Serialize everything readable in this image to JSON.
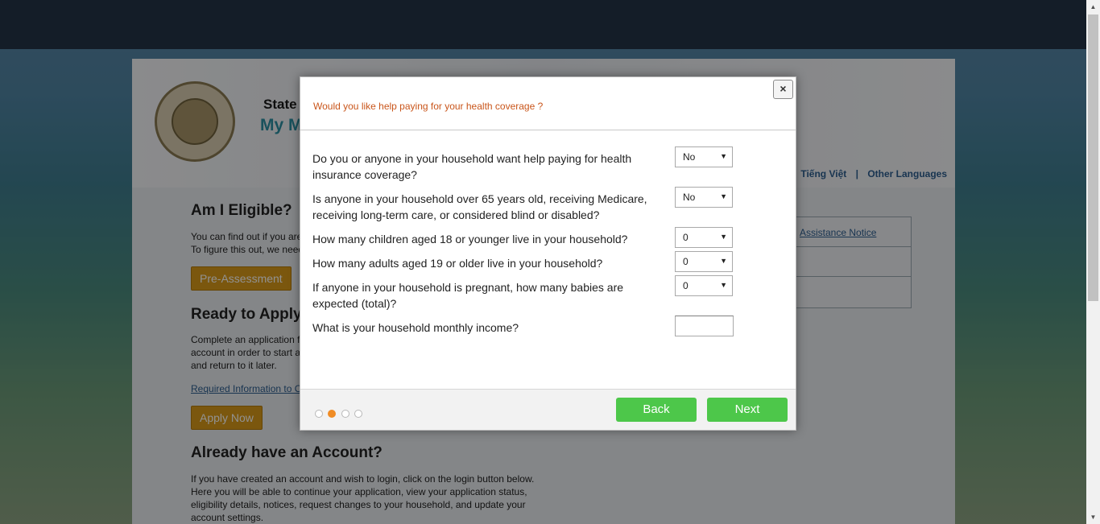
{
  "background_page": {
    "state_title": "State",
    "my_title": "My M",
    "languages": [
      "Tiếng Việt",
      "Other Languages"
    ],
    "lang_separator": "|",
    "right_panel_items": [
      "Assistance Notice",
      "",
      ""
    ],
    "eligible_heading": "Am I Eligible?",
    "eligible_text": [
      "You can find out if you are",
      "To figure this out, we need"
    ],
    "pre_assessment_label": "Pre-Assessment",
    "ready_heading": "Ready to Apply",
    "ready_text": [
      "Complete an application f",
      "account in order to start a",
      "and return to it later."
    ],
    "required_link": "Required Information to C",
    "apply_now_label": "Apply Now",
    "account_heading": "Already have an Account?",
    "account_text": [
      "If you have created an account and wish to login, click on the login button below.",
      "Here you will be able to continue your application, view your application status,",
      "eligibility details, notices, request changes to your household, and update your",
      "account settings."
    ]
  },
  "modal": {
    "title": "Would you like help paying for your health coverage ?",
    "close_label": "×",
    "questions": [
      {
        "label": "Do you or anyone in your household want help paying for health insurance coverage?",
        "value": "No"
      },
      {
        "label": "Is anyone in your household over 65 years old, receiving Medicare, receiving long-term care, or considered blind or disabled?",
        "value": "No"
      },
      {
        "label": "How many children aged 18 or younger live in your household?",
        "value": "0"
      },
      {
        "label": "How many adults aged 19 or older live in your household?",
        "value": "0"
      },
      {
        "label": "If anyone in your household is pregnant, how many babies are expected (total)?",
        "value": "0"
      },
      {
        "label": "What is your household monthly income?",
        "value": ""
      }
    ],
    "step_dots": 4,
    "active_step": 2,
    "back_label": "Back",
    "next_label": "Next"
  },
  "colors": {
    "topbar": "#243447",
    "title_orange": "#c9551a",
    "button_green": "#4dc74a",
    "button_gold": "#d99a1a",
    "active_dot": "#f08c25"
  }
}
